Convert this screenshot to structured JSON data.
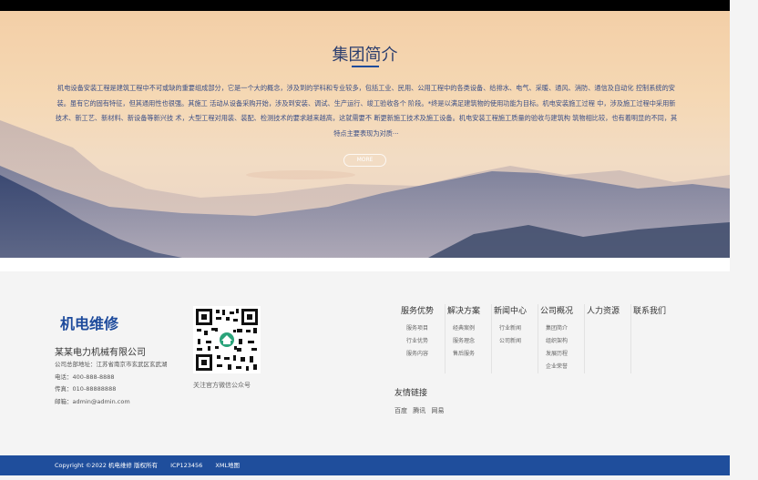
{
  "about": {
    "title": "集团简介",
    "paragraph": "机电设备安装工程是建筑工程中不可或缺的重要组成部分，它是一个大的概念，涉及到的学科和专业较多，包括工业、民用、公用工程中的各类设备、给排水、电气、采暖、通风、消防、通信及自动化 控制系统的安装。虽有它的固有特征，但其通用性也很强。其施工 活动从设备采购开始，涉及到安装、调试、生产运行、竣工验收各个 阶段。*终是以满足建筑物的使用功能为目标。机电安装施工过程 中，涉及施工过程中采用新技术、新工艺、新材料、新设备等新兴技 术，大型工程对用装、装配、检测技术的要求越来越高，这就需要不 断更新施工技术及施工设备。机电安装工程施工质量的验收与建筑构 筑物相比较，也有着明显的不同，其特点主要表现为对质···",
    "more_label": "MORE"
  },
  "footer": {
    "logo": "机电维修",
    "company_name": "某某电力机械有限公司",
    "address": "公司总部地址：江苏省南京市玄武区玄武湖",
    "phone": "电话：400-888-8888",
    "fax": "传真：010-88888888",
    "email": "邮箱：admin@admin.com",
    "qr_caption": "关注官方微信公众号",
    "nav": [
      {
        "label": "服务优势",
        "items": [
          "服务项目",
          "行业优势",
          "服务内容"
        ]
      },
      {
        "label": "解决方案",
        "items": [
          "经典案例",
          "服务理念",
          "售后服务"
        ]
      },
      {
        "label": "新闻中心",
        "items": [
          "行业新闻",
          "公司新闻"
        ]
      },
      {
        "label": "公司概况",
        "items": [
          "集团简介",
          "组织架构",
          "发展历程",
          "企业荣誉"
        ]
      },
      {
        "label": "人力资源",
        "items": []
      },
      {
        "label": "联系我们",
        "items": []
      }
    ],
    "links_title": "友情链接",
    "links": [
      "百度",
      "腾讯",
      "网易"
    ]
  },
  "bottom_bar": {
    "copyright": "Copyright ©2022 机电维修 版权所有",
    "icp": "ICP123456",
    "sitemap": "XML地图"
  },
  "colors": {
    "brand": "#1e4b9c",
    "bottom_bar": "#1f4e9c",
    "topbar": "#000000"
  }
}
